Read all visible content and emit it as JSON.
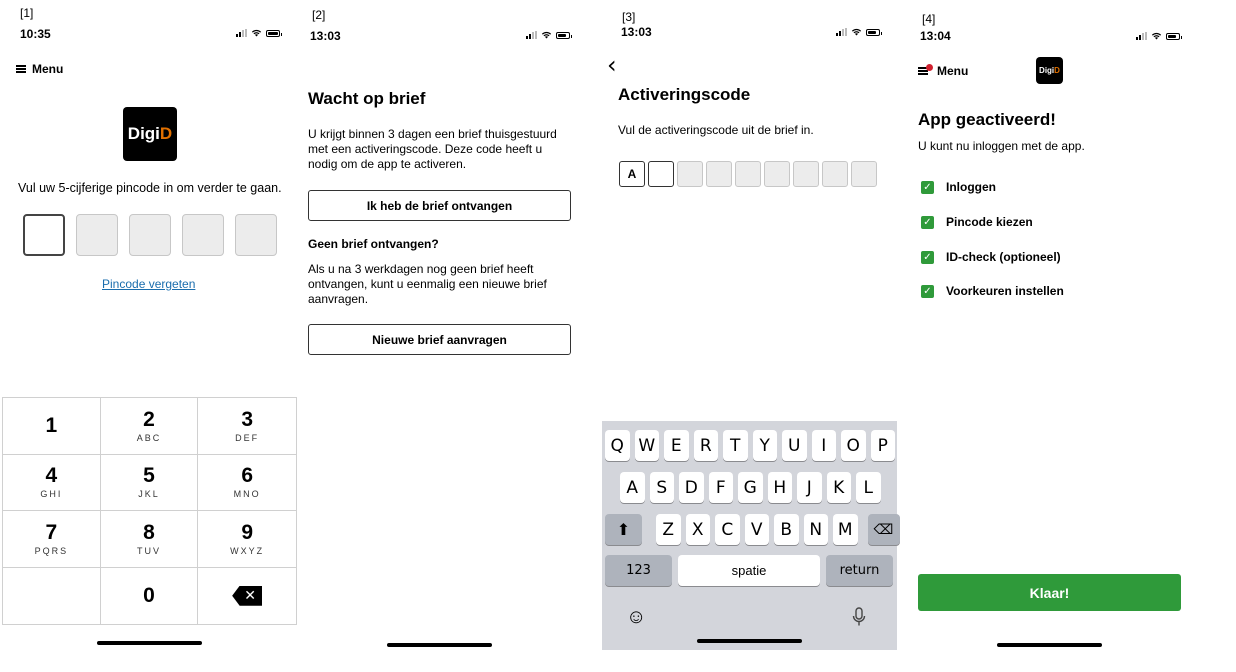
{
  "panels": [
    {
      "label": "[1]",
      "time": "10:35"
    },
    {
      "label": "[2]",
      "time": "13:03"
    },
    {
      "label": "[3]",
      "time": "13:03"
    },
    {
      "label": "[4]",
      "time": "13:04"
    }
  ],
  "screen1": {
    "menu_label": "Menu",
    "logo_text_a": "Digi",
    "logo_text_b": "D",
    "instruction": "Vul uw 5-cijferige pincode in om verder te gaan.",
    "forgot_link": "Pincode vergeten",
    "keys": [
      {
        "digit": "1",
        "letters": ""
      },
      {
        "digit": "2",
        "letters": "ABC"
      },
      {
        "digit": "3",
        "letters": "DEF"
      },
      {
        "digit": "4",
        "letters": "GHI"
      },
      {
        "digit": "5",
        "letters": "JKL"
      },
      {
        "digit": "6",
        "letters": "MNO"
      },
      {
        "digit": "7",
        "letters": "PQRS"
      },
      {
        "digit": "8",
        "letters": "TUV"
      },
      {
        "digit": "9",
        "letters": "WXYZ"
      },
      {
        "digit": "0",
        "letters": ""
      }
    ],
    "delete_glyph": "✕"
  },
  "screen2": {
    "title": "Wacht op brief",
    "intro": "U krijgt binnen 3 dagen een brief thuisgestuurd met een activeringscode. Deze code heeft u nodig om de app te activeren.",
    "received_button": "Ik heb de brief ontvangen",
    "subheading": "Geen brief ontvangen?",
    "subtext": "Als u na 3 werkdagen nog geen brief heeft ontvangen, kunt u eenmalig een nieuwe brief aanvragen.",
    "new_letter_button": "Nieuwe brief aanvragen"
  },
  "screen3": {
    "back_glyph": "‹",
    "title": "Activeringscode",
    "instruction": "Vul de activeringscode uit de brief in.",
    "code_first_char": "A",
    "keyboard_row1": [
      "Q",
      "W",
      "E",
      "R",
      "T",
      "Y",
      "U",
      "I",
      "O",
      "P"
    ],
    "keyboard_row2": [
      "A",
      "S",
      "D",
      "F",
      "G",
      "H",
      "J",
      "K",
      "L"
    ],
    "keyboard_row3": [
      "Z",
      "X",
      "C",
      "V",
      "B",
      "N",
      "M"
    ],
    "numbers_key": "123",
    "space_key": "spatie",
    "return_key": "return"
  },
  "screen4": {
    "menu_label": "Menu",
    "logo_text_a": "Digi",
    "logo_text_b": "D",
    "title": "App geactiveerd!",
    "subtitle": "U kunt nu inloggen met de app.",
    "steps": [
      "Inloggen",
      "Pincode kiezen",
      "ID-check (optioneel)",
      "Voorkeuren instellen"
    ],
    "done_button": "Klaar!"
  },
  "colors": {
    "accent_green": "#2f9a3a",
    "link_blue": "#1a6dad",
    "logo_orange": "#e17000",
    "keyboard_bg": "#d3d5db"
  }
}
